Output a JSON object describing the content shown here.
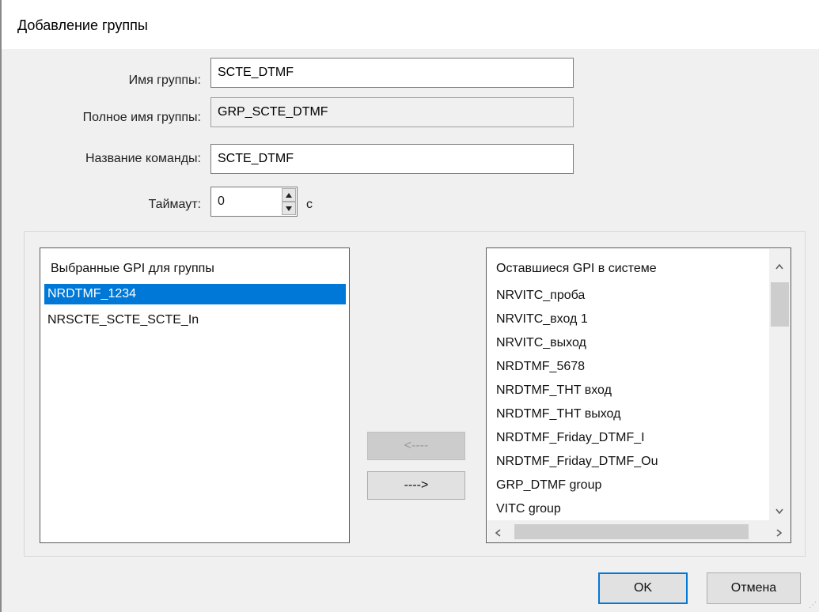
{
  "window": {
    "title": "Добавление группы"
  },
  "form": {
    "group_name_label": "Имя группы:",
    "group_name_value": "SCTE_DTMF",
    "full_name_label": "Полное имя группы:",
    "full_name_value": "GRP_SCTE_DTMF",
    "command_name_label": "Название команды:",
    "command_name_value": "SCTE_DTMF",
    "timeout_label": "Таймаут:",
    "timeout_value": "0",
    "timeout_unit": "с"
  },
  "selected_list": {
    "header": "Выбранные GPI для группы",
    "items": [
      "NRDTMF_1234",
      "NRSCTE_SCTE_SCTE_In"
    ],
    "selected_index": 0
  },
  "remaining_list": {
    "header": "Оставшиеся GPI в системе",
    "items": [
      "NRVITC_проба",
      "NRVITC_вход 1",
      "NRVITC_выход",
      "NRDTMF_5678",
      "NRDTMF_THT вход",
      "NRDTMF_THT выход",
      "NRDTMF_Friday_DTMF_I",
      "NRDTMF_Friday_DTMF_Ou",
      "GRP_DTMF group",
      "VITC group"
    ]
  },
  "move_buttons": {
    "move_left": "<----",
    "move_right": "---->"
  },
  "buttons": {
    "ok": "OK",
    "cancel": "Отмена"
  }
}
